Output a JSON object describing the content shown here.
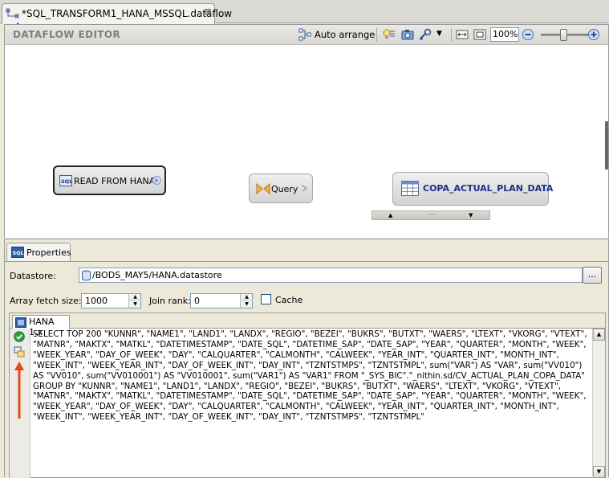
{
  "tab": {
    "title": "*SQL_TRANSFORM1_HANA_MSSQL.dataflow",
    "close_glyph": "⊠"
  },
  "editor": {
    "title": "DATAFLOW EDITOR",
    "toolbar": {
      "auto_arrange_label": "Auto arrange",
      "zoom_value": "100%"
    },
    "nodes": {
      "read": "READ FROM HANA",
      "query": "Query",
      "target": "COPA_ACTUAL_PLAN_DATA"
    }
  },
  "properties": {
    "tab_label": "Properties",
    "datastore_label": "Datastore:",
    "datastore_value": "/BODS_MAY5/HANA.datastore",
    "browse_label": "...",
    "array_fetch_label": "Array fetch size:",
    "array_fetch_value": "1000",
    "join_rank_label": "Join rank:",
    "join_rank_value": "0",
    "cache_label": "Cache",
    "cache_checked": false,
    "sql_tab_label": "HANA 1.x",
    "sql_text": "SELECT TOP 200 \"KUNNR\", \"NAME1\", \"LAND1\", \"LANDX\", \"REGIO\", \"BEZEI\", \"BUKRS\", \"BUTXT\", \"WAERS\", \"LTEXT\", \"VKORG\", \"VTEXT\", \"MATNR\", \"MAKTX\", \"MATKL\", \"DATETIMESTAMP\", \"DATE_SQL\", \"DATETIME_SAP\", \"DATE_SAP\", \"YEAR\", \"QUARTER\", \"MONTH\", \"WEEK\", \"WEEK_YEAR\", \"DAY_OF_WEEK\", \"DAY\", \"CALQUARTER\", \"CALMONTH\", \"CALWEEK\", \"YEAR_INT\", \"QUARTER_INT\", \"MONTH_INT\", \"WEEK_INT\", \"WEEK_YEAR_INT\", \"DAY_OF_WEEK_INT\", \"DAY_INT\", \"TZNTSTMPS\", \"TZNTSTMPL\", sum(\"VAR\") AS \"VAR\", sum(\"VV010\") AS \"VV010\", sum(\"VV010001\") AS \"VV010001\", sum(\"VAR1\") AS \"VAR1\" FROM \"_SYS_BIC\".\"_nithin.sd/CV_ACTUAL_PLAN_COPA_DATA\" GROUP BY \"KUNNR\", \"NAME1\", \"LAND1\", \"LANDX\", \"REGIO\", \"BEZEI\", \"BUKRS\", \"BUTXT\", \"WAERS\", \"LTEXT\", \"VKORG\", \"VTEXT\", \"MATNR\", \"MAKTX\", \"MATKL\", \"DATETIMESTAMP\", \"DATE_SQL\", \"DATETIME_SAP\", \"DATE_SAP\", \"YEAR\", \"QUARTER\", \"MONTH\", \"WEEK\", \"WEEK_YEAR\", \"DAY_OF_WEEK\", \"DAY\", \"CALQUARTER\", \"CALMONTH\", \"CALWEEK\", \"YEAR_INT\", \"QUARTER_INT\", \"MONTH_INT\", \"WEEK_INT\", \"WEEK_YEAR_INT\", \"DAY_OF_WEEK_INT\", \"DAY_INT\", \"TZNTSTMPS\", \"TZNTSTMPL\""
  },
  "icons": {
    "dataflow_tab": "dataflow-icon",
    "auto_arrange": "auto-arrange-icon",
    "validate_ok": "check-circle-icon",
    "arrow_annotation": "red-up-arrow-icon"
  },
  "colors": {
    "accent_blue": "#1a2f8a",
    "ok_green": "#2ea043",
    "annotation_red": "#e04a1a"
  }
}
